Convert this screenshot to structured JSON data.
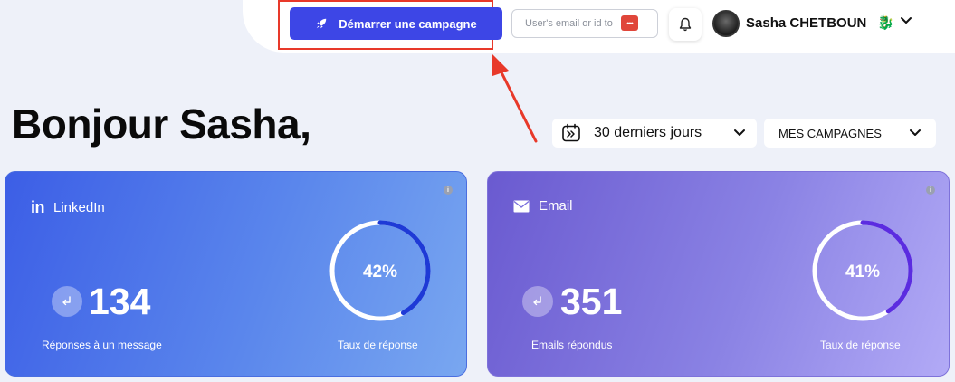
{
  "header": {
    "cta_label": "Démarrer une campagne",
    "search_placeholder": "User's email or id to",
    "badge_text": "•••",
    "user_name": "Sasha CHETBOUN",
    "user_emoji": "🐉"
  },
  "greeting": "Bonjour Sasha,",
  "filters": {
    "date_range": "30 derniers jours",
    "campaigns": "MES CAMPAGNES"
  },
  "cards": [
    {
      "channel": "LinkedIn",
      "icon": "linkedin-icon",
      "count": "134",
      "count_label": "Réponses à un message",
      "rate": "42%",
      "rate_value": 0.42,
      "rate_label": "Taux de réponse",
      "ring_color": "#1e3ad6"
    },
    {
      "channel": "Email",
      "icon": "mail-icon",
      "count": "351",
      "count_label": "Emails répondus",
      "rate": "41%",
      "rate_value": 0.41,
      "rate_label": "Taux de réponse",
      "ring_color": "#5b2ce0"
    }
  ],
  "colors": {
    "accent": "#3d46e6",
    "highlight": "#e8392a"
  }
}
